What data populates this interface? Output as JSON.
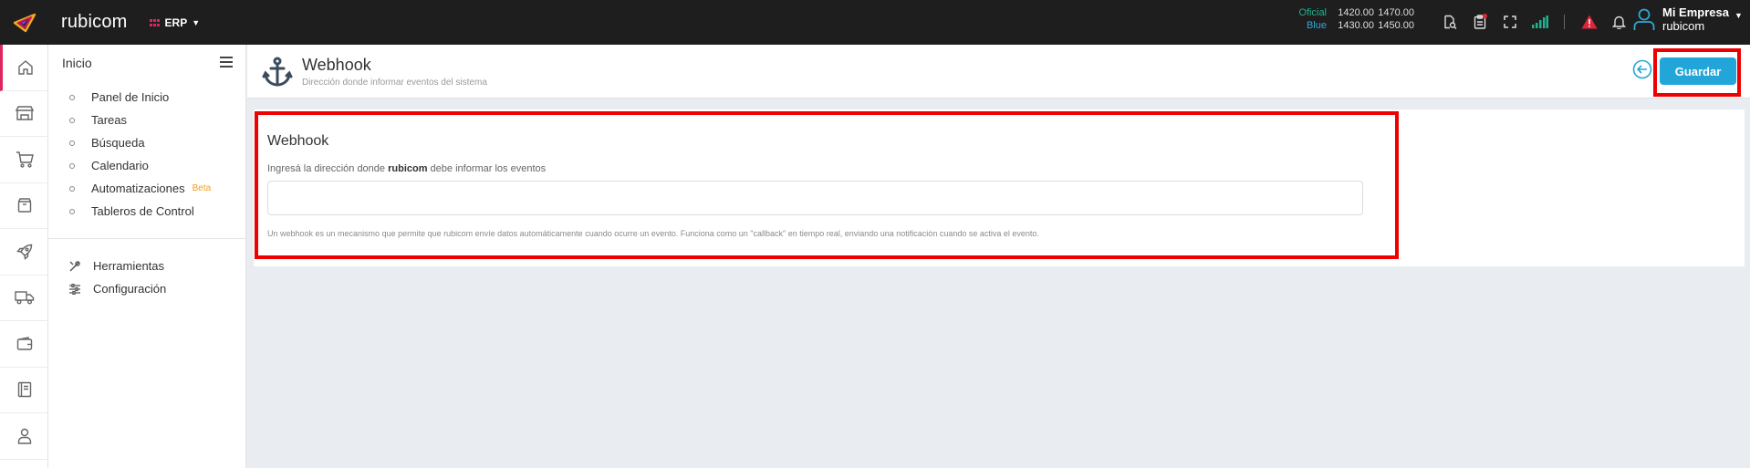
{
  "topbar": {
    "brand": "rubicom",
    "module": "ERP",
    "rates": [
      {
        "label": "Oficial",
        "buy": "1420.00",
        "sell": "1470.00",
        "color": "#1fb28f"
      },
      {
        "label": "Blue",
        "buy": "1430.00",
        "sell": "1450.00",
        "color": "#2aa9d8"
      }
    ],
    "icons": [
      "document-search-icon",
      "clipboard-icon",
      "fullscreen-icon",
      "signal-icon",
      "alert-icon",
      "bell-icon",
      "user-icon"
    ],
    "user": {
      "company": "Mi Empresa",
      "name": "rubicom"
    }
  },
  "rail": {
    "icons": [
      "home-icon",
      "store-icon",
      "cart-icon",
      "box-icon",
      "rocket-icon",
      "truck-icon",
      "wallet-icon",
      "book-icon",
      "person-icon"
    ]
  },
  "sidebar": {
    "title": "Inicio",
    "items": [
      {
        "label": "Panel de Inicio"
      },
      {
        "label": "Tareas"
      },
      {
        "label": "Búsqueda"
      },
      {
        "label": "Calendario"
      },
      {
        "label": "Automatizaciones",
        "badge": "Beta"
      },
      {
        "label": "Tableros de Control"
      }
    ],
    "tools": [
      {
        "label": "Herramientas",
        "icon": "tools-icon"
      },
      {
        "label": "Configuración",
        "icon": "sliders-icon"
      }
    ]
  },
  "page": {
    "title": "Webhook",
    "subtitle": "Dirección donde informar eventos del sistema",
    "save_label": "Guardar"
  },
  "card": {
    "title": "Webhook",
    "label_pre": "Ingresá la dirección donde ",
    "label_bold": "rubicom",
    "label_post": " debe informar los eventos",
    "input_value": "",
    "help": "Un webhook es un mecanismo que permite que rubicom envíe datos automáticamente cuando ocurre un evento. Funciona como un \"callback\" en tiempo real, enviando una notificación cuando se activa el evento."
  },
  "colors": {
    "accent": "#22a6d9",
    "highlight": "#ee0000",
    "topbar": "#1e1e1e"
  }
}
